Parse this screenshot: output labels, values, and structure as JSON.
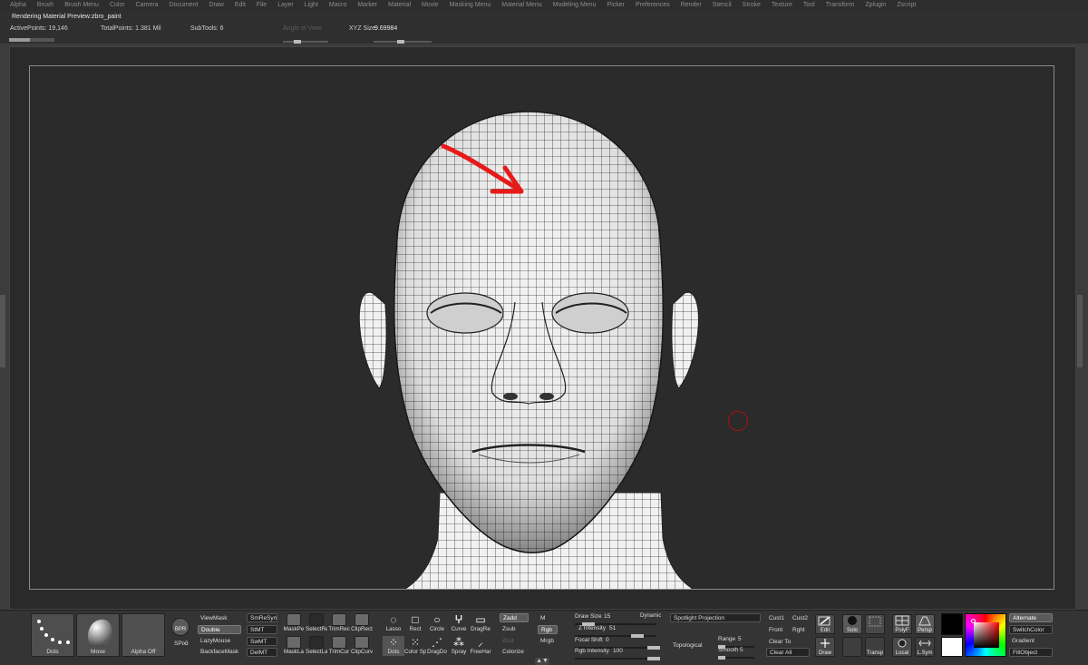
{
  "menu": [
    "Alpha",
    "Brush",
    "Brush Menu",
    "Color",
    "Camera",
    "Document",
    "Draw",
    "Edit",
    "File",
    "Layer",
    "Light",
    "Macro",
    "Marker",
    "Material",
    "Movie",
    "Masking Menu",
    "Material Menu",
    "Modeling Menu",
    "Picker",
    "Preferences",
    "Render",
    "Stencil",
    "Stroke",
    "Texture",
    "Tool",
    "Transform",
    "Zplugin",
    "Zscript"
  ],
  "info": {
    "status": "Rendering Material Preview:zbro_paint",
    "active_points": "ActivePoints: 19,146",
    "total_points": "TotalPoints: 1.381 Mil",
    "subtools": "SubTools: 6",
    "xyz_size_label": "XYZ Size",
    "xyz_size_value": "9.69984",
    "dim_label": "Angle of View"
  },
  "progress_fraction": 0.45,
  "shelf": {
    "brush_stroke": "Dots",
    "brush": "Move",
    "alpha": "Alpha Off",
    "bpr": "BPR",
    "spix_label": "SPix",
    "spix_value": "3",
    "view_mask": "ViewMask",
    "double": "Double",
    "lazy_mouse": "LazyMouse",
    "backface_mask": "BackfaceMask",
    "sm_resym": "SmReSym",
    "st_mt": "StMT",
    "sw_mt": "SwMT",
    "del_mt": "DelMT",
    "tools_top": [
      "MaskPe",
      "SelectRe",
      "TrimRec",
      "ClipRect"
    ],
    "tools_bot": [
      "MaskLa",
      "SelectLa",
      "TrimCur",
      "ClipCurv"
    ],
    "shapes_top": [
      "Lasso",
      "Rect",
      "Circle",
      "Curve",
      "DragRe"
    ],
    "shapes_bot": [
      "Dots",
      "Color Sp",
      "DragDo",
      "Spray",
      "FreeHar"
    ],
    "zadd": "Zadd",
    "zsub": "Zsub",
    "zcut": "Zcut",
    "colorize": "Colorize",
    "m": "M",
    "rgb": "Rgb",
    "mrgb": "Mrgb",
    "draw_size_label": "Draw Size",
    "draw_size": "15",
    "dynamic": "Dynamic",
    "z_intensity_label": "Z Intensity",
    "z_intensity": "51",
    "focal_shift_label": "Focal Shift",
    "focal_shift": "0",
    "rgb_intensity_label": "Rgb Intensity",
    "rgb_intensity": "100",
    "spotlight": "Spotlight Projection",
    "topological": "Topological",
    "range_label": "Range",
    "range": "5",
    "smooth_label": "Smooth",
    "smooth": "5",
    "cust1": "Cust1",
    "cust2": "Cust2",
    "front": "Front",
    "rght": "Rght",
    "clear_to": "Clear To",
    "clear_all": "Clear All",
    "edit": "Edit",
    "draw": "Draw",
    "solo": "Solo",
    "transp": "Transp",
    "polyf": "PolyF",
    "persp": "Persp",
    "local": "Local",
    "lsym": "L.Sym",
    "alternate": "Alternate",
    "switch_color": "SwitchColor",
    "gradient": "Gradient",
    "fill_object": "FillObject"
  },
  "colors": {
    "primary_swatch": "#000000",
    "secondary_swatch": "#ffffff",
    "annotation_arrow": "#e81919",
    "brush_cursor": "#b01010"
  }
}
